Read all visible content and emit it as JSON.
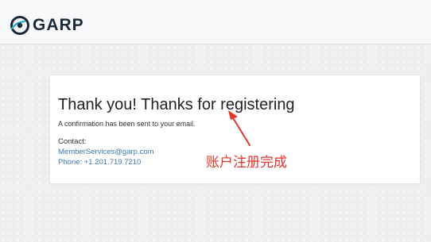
{
  "header": {
    "logo_text": "GARP"
  },
  "card": {
    "title": "Thank you! Thanks for registering",
    "confirmation": "A confirmation has been sent to your email.",
    "contact_label": "Contact:",
    "email": "MemberServices@garp.com",
    "phone": "Phone: +1.201.719.7210"
  },
  "annotation": {
    "text": "账户注册完成",
    "color": "#e8342a"
  },
  "icons": {
    "logo_mark": "garp-logo-icon",
    "annotation_arrow": "arrow-icon"
  }
}
